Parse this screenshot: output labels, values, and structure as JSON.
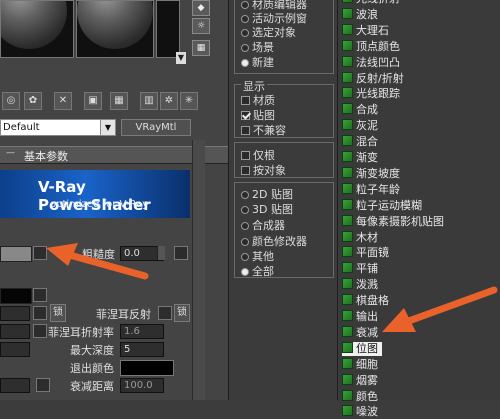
{
  "material_editor": {
    "material_name": "Default",
    "material_type": "VRayMtl",
    "rollout_title": "基本参数",
    "banner": {
      "title": "V-Ray PowerShader",
      "subtitle": "optimized for V-Ray"
    },
    "roughness_label": "粗糙度",
    "roughness_value": "0.0",
    "lock_label": "锁",
    "fresnel_label": "菲涅耳反射",
    "fresnel_ior_label": "菲涅耳折射率",
    "fresnel_ior_value": "1.6",
    "max_depth_label": "最大深度",
    "max_depth_value": "5",
    "exit_color_label": "退出颜色",
    "dim_distance_label": "衰减距离",
    "dim_distance_value": "100.0"
  },
  "browser_options": {
    "browse_from": [
      {
        "label": "材质编辑器",
        "selected": false
      },
      {
        "label": "活动示例窗",
        "selected": false
      },
      {
        "label": "选定对象",
        "selected": false
      },
      {
        "label": "场景",
        "selected": false
      },
      {
        "label": "新建",
        "selected": true
      }
    ],
    "show_title": "显示",
    "show": [
      {
        "label": "材质",
        "checked": false
      },
      {
        "label": "贴图",
        "checked": true
      },
      {
        "label": "不兼容",
        "checked": false
      }
    ],
    "filters": [
      {
        "label": "仅根",
        "checked": false
      },
      {
        "label": "按对象",
        "checked": false
      }
    ],
    "categories": [
      {
        "label": "2D 贴图",
        "selected": false
      },
      {
        "label": "3D 贴图",
        "selected": false
      },
      {
        "label": "合成器",
        "selected": false
      },
      {
        "label": "颜色修改器",
        "selected": false
      },
      {
        "label": "其他",
        "selected": false
      },
      {
        "label": "全部",
        "selected": true
      }
    ]
  },
  "map_list": {
    "items": [
      "光线折射",
      "波浪",
      "大理石",
      "顶点颜色",
      "法线凹凸",
      "反射/折射",
      "光线跟踪",
      "合成",
      "灰泥",
      "混合",
      "渐变",
      "渐变坡度",
      "粒子年龄",
      "粒子运动模糊",
      "每像素摄影机贴图",
      "木材",
      "平面镜",
      "平铺",
      "泼溅",
      "棋盘格",
      "输出",
      "衰减",
      "位图",
      "细胞",
      "烟雾",
      "颜色",
      "噪波"
    ],
    "selected": "位图"
  },
  "colors": {
    "arrow": "#e8622a",
    "map_icon": "#2f8f2f"
  }
}
